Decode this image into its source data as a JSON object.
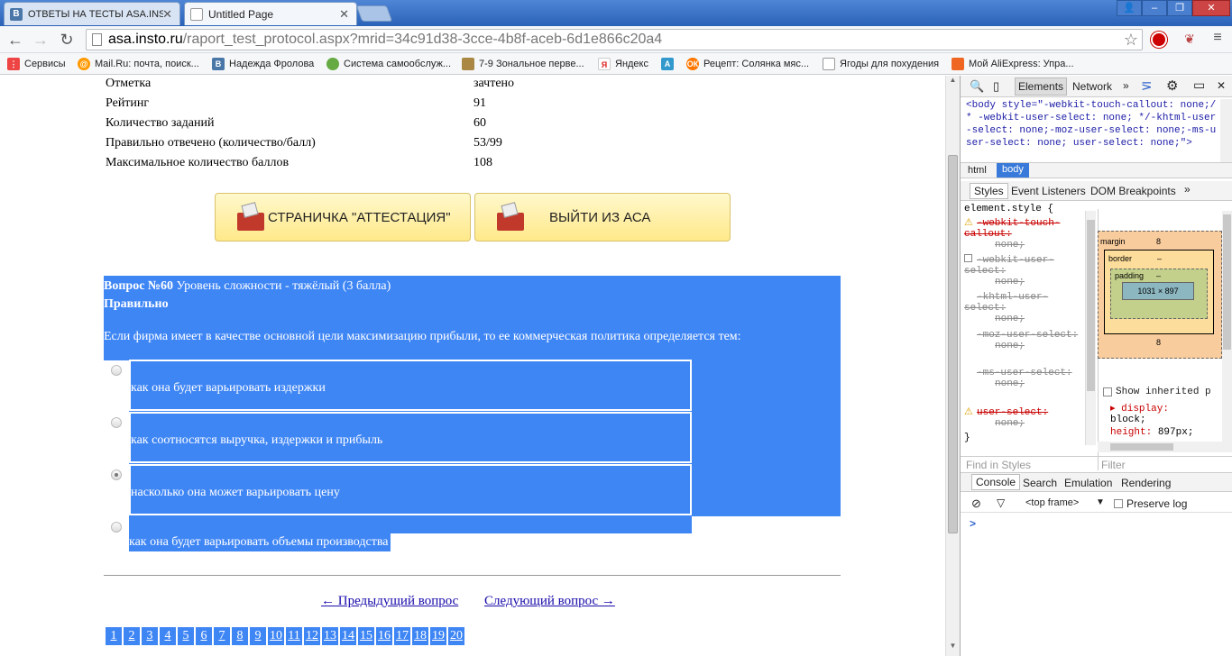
{
  "browser": {
    "tabs": [
      {
        "label": "ОТВЕТЫ НА ТЕСТЫ ASA.INS",
        "icon": "vk-icon",
        "active": false
      },
      {
        "label": "Untitled Page",
        "icon": "page-icon",
        "active": true
      }
    ],
    "url_host": "asa.insto.ru",
    "url_path": "/raport_test_protocol.aspx?mrid=34c91d38-3cce-4b8f-aceb-6d1e866c20a4",
    "bookmarks": [
      {
        "label": "Сервисы",
        "icon": "apps-icon",
        "color": "#e44"
      },
      {
        "label": "Mail.Ru: почта, поиск...",
        "icon": "mailru-icon",
        "color": "#f90"
      },
      {
        "label": "Надежда Фролова",
        "icon": "vk-icon",
        "color": "#4a76a8"
      },
      {
        "label": "Система самообслуж...",
        "icon": "globe-icon",
        "color": "#6a4"
      },
      {
        "label": "7-9 Зональное перве...",
        "icon": "photo-icon",
        "color": "#a84"
      },
      {
        "label": "Яндекс",
        "icon": "yandex-icon",
        "color": "#d22"
      },
      {
        "label": "",
        "icon": "translate-icon",
        "color": "#39c"
      },
      {
        "label": "Рецепт: Солянка мяс...",
        "icon": "ok-icon",
        "color": "#f70"
      },
      {
        "label": "Ягоды для похудения",
        "icon": "page-icon",
        "color": "#999"
      },
      {
        "label": "Мой AliExpress: Упра...",
        "icon": "aliexpress-icon",
        "color": "#e62"
      }
    ]
  },
  "summary": {
    "rows": [
      {
        "label": "Отметка",
        "value": "зачтено"
      },
      {
        "label": "Рейтинг",
        "value": "91"
      },
      {
        "label": "Количество заданий",
        "value": "60"
      },
      {
        "label": "Правильно отвечено (количество/балл)",
        "value": "53/99"
      },
      {
        "label": "Максимальное количество баллов",
        "value": "108"
      }
    ]
  },
  "buttons": {
    "attestation": "СТРАНИЧКА \"АТТЕСТАЦИЯ\"",
    "exit": "ВЫЙТИ ИЗ АСА"
  },
  "question": {
    "number_label": "Вопрос №60",
    "difficulty": "Уровень сложности - тяжёлый (3 балла)",
    "status": "Правильно",
    "text": "Если фирма имеет в качестве основной цели максимизацию прибыли, то ее коммерческая политика определяется тем:",
    "answers": [
      {
        "text": "как она будет варьировать издержки",
        "selected": false
      },
      {
        "text": "как соотносятся выручка, издержки и прибыль",
        "selected": false
      },
      {
        "text": "насколько она может варьировать цену",
        "selected": true
      },
      {
        "text": "как она будет варьировать объемы производства",
        "selected": false
      }
    ]
  },
  "navigation": {
    "prev": "← Предыдущий вопрос",
    "next": "Следующий вопрос →",
    "pages": [
      "1",
      "2",
      "3",
      "4",
      "5",
      "6",
      "7",
      "8",
      "9",
      "10",
      "11",
      "12",
      "13",
      "14",
      "15",
      "16",
      "17",
      "18",
      "19",
      "20"
    ]
  },
  "devtools": {
    "tabs": [
      "Elements",
      "Network"
    ],
    "dom_code": "<body style=\"-webkit-touch-callout: none;/* -webkit-user-select: none; */-khtml-user-select: none;-moz-user-select: none;-ms-user-select: none; user-select: none;\">",
    "breadcrumbs": [
      "html",
      "body"
    ],
    "subtabs": [
      "Styles",
      "Event Listeners",
      "DOM Breakpoints"
    ],
    "element_style": "element.style {",
    "rules": [
      {
        "prop": "-webkit-touch-callout:",
        "val": "none;",
        "warn": true
      },
      {
        "prop": "-webkit-user-select:",
        "val": "none;",
        "warn": false,
        "checkbox": true
      },
      {
        "prop": "-khtml-user-select:",
        "val": "none;",
        "warn": false
      },
      {
        "prop": "-moz-user-select:",
        "val": "none;",
        "warn": false
      },
      {
        "prop": "-ms-user-select:",
        "val": "none;",
        "warn": false
      },
      {
        "prop": "user-select:",
        "val": "none;",
        "warn": true
      }
    ],
    "closing": "}",
    "find_placeholder": "Find in Styles",
    "filter_placeholder": "Filter",
    "boxmodel": {
      "margin_label": "margin",
      "margin": "8",
      "border_label": "border",
      "border": "–",
      "padding_label": "padding",
      "padding": "–",
      "size": "1031 × 897"
    },
    "show_inherited": "Show inherited p",
    "computed": [
      {
        "prop": "display:",
        "val": "block;"
      },
      {
        "prop": "height:",
        "val": "897px;"
      }
    ],
    "drawer_tabs": [
      "Console",
      "Search",
      "Emulation",
      "Rendering"
    ],
    "frame": "<top frame>",
    "preserve_log": "Preserve log",
    "prompt": ">"
  }
}
